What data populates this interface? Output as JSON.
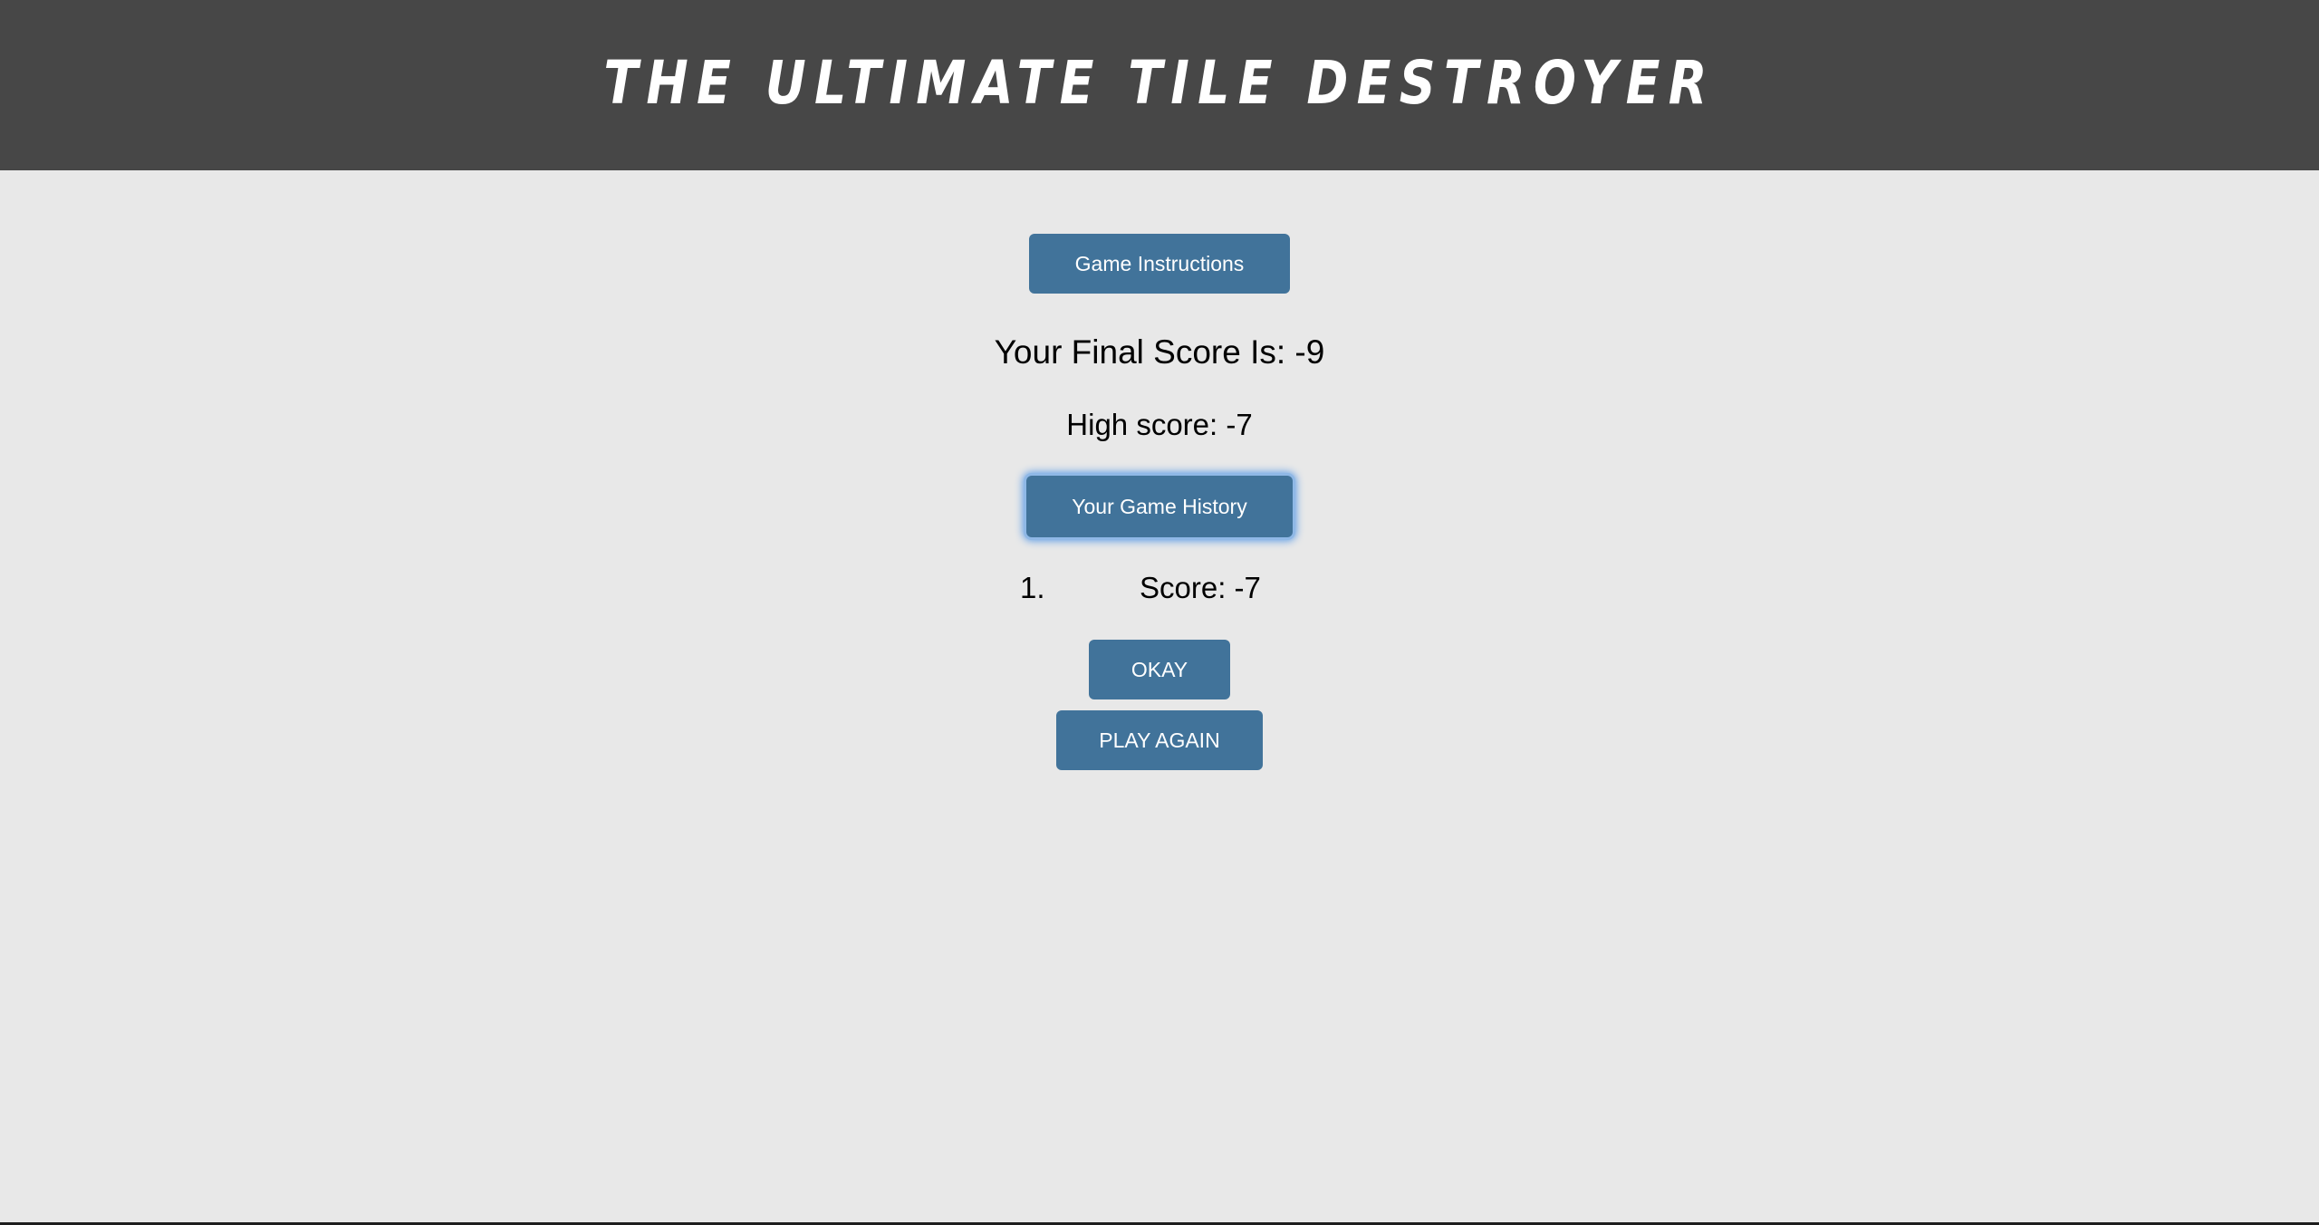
{
  "header": {
    "title": "THE ULTIMATE TILE DESTROYER"
  },
  "main": {
    "instructions_button": "Game Instructions",
    "final_score_text": "Your Final Score Is: -9",
    "high_score_text": "High score: -7",
    "history_button": "Your Game History",
    "history": [
      {
        "rank": "1.",
        "score": "Score: -7"
      }
    ],
    "okay_button": "OKAY",
    "play_again_button": "PLAY AGAIN"
  },
  "colors": {
    "header_bg": "#474747",
    "page_bg": "#e8e8e8",
    "button_bg": "#41739a",
    "focus_ring": "#5c9ce6"
  }
}
